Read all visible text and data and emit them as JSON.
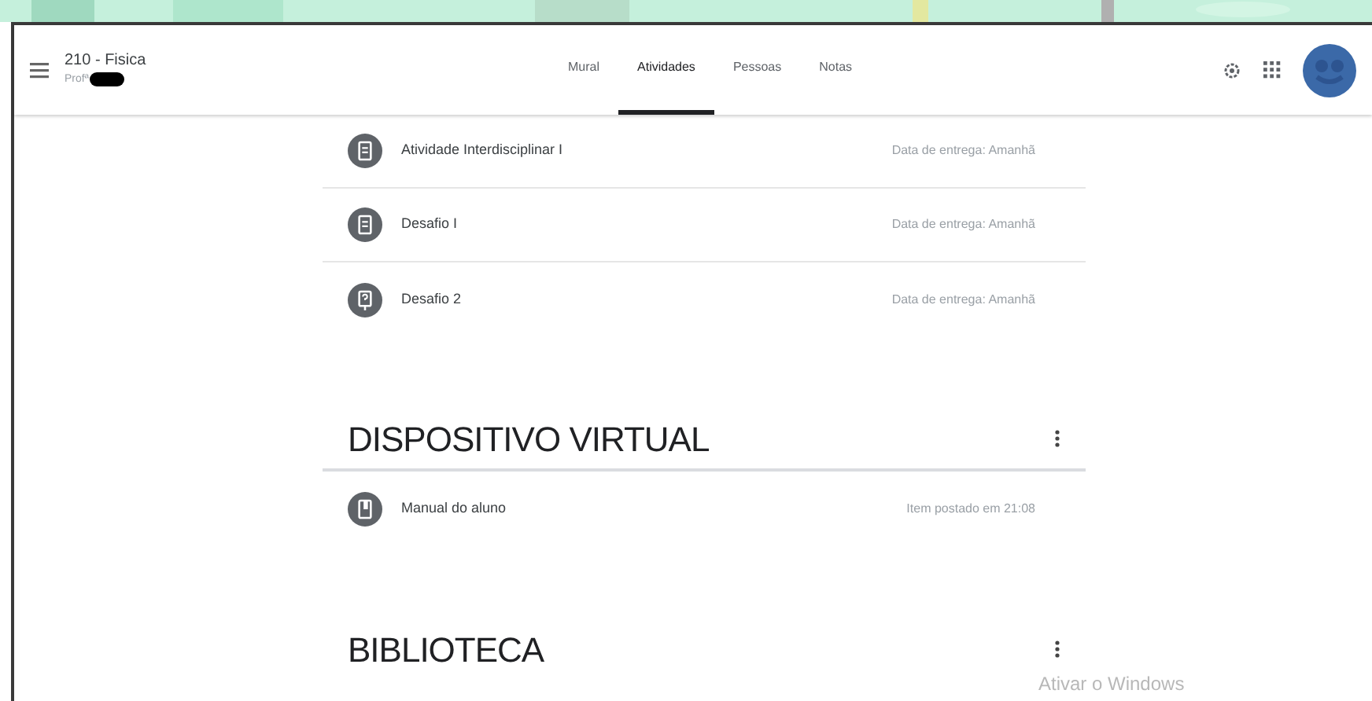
{
  "header": {
    "title": "210 - Fisica",
    "subtitle": "Profª",
    "tabs": [
      {
        "label": "Mural",
        "selected": false
      },
      {
        "label": "Atividades",
        "selected": true
      },
      {
        "label": "Pessoas",
        "selected": false
      },
      {
        "label": "Notas",
        "selected": false
      }
    ]
  },
  "items": [
    {
      "kind": "assignment",
      "title": "Atividade Interdisciplinar I",
      "meta": "Data de entrega: Amanhã"
    },
    {
      "kind": "assignment",
      "title": "Desafio I",
      "meta": "Data de entrega: Amanhã"
    },
    {
      "kind": "question",
      "title": "Desafio 2",
      "meta": "Data de entrega: Amanhã"
    }
  ],
  "sections": [
    {
      "title": "DISPOSITIVO VIRTUAL",
      "items": [
        {
          "kind": "material",
          "title": "Manual do aluno",
          "meta": "Item postado em 21:08"
        }
      ]
    },
    {
      "title": "BIBLIOTECA"
    }
  ],
  "overlay": {
    "text": "Ativar o Windows"
  }
}
